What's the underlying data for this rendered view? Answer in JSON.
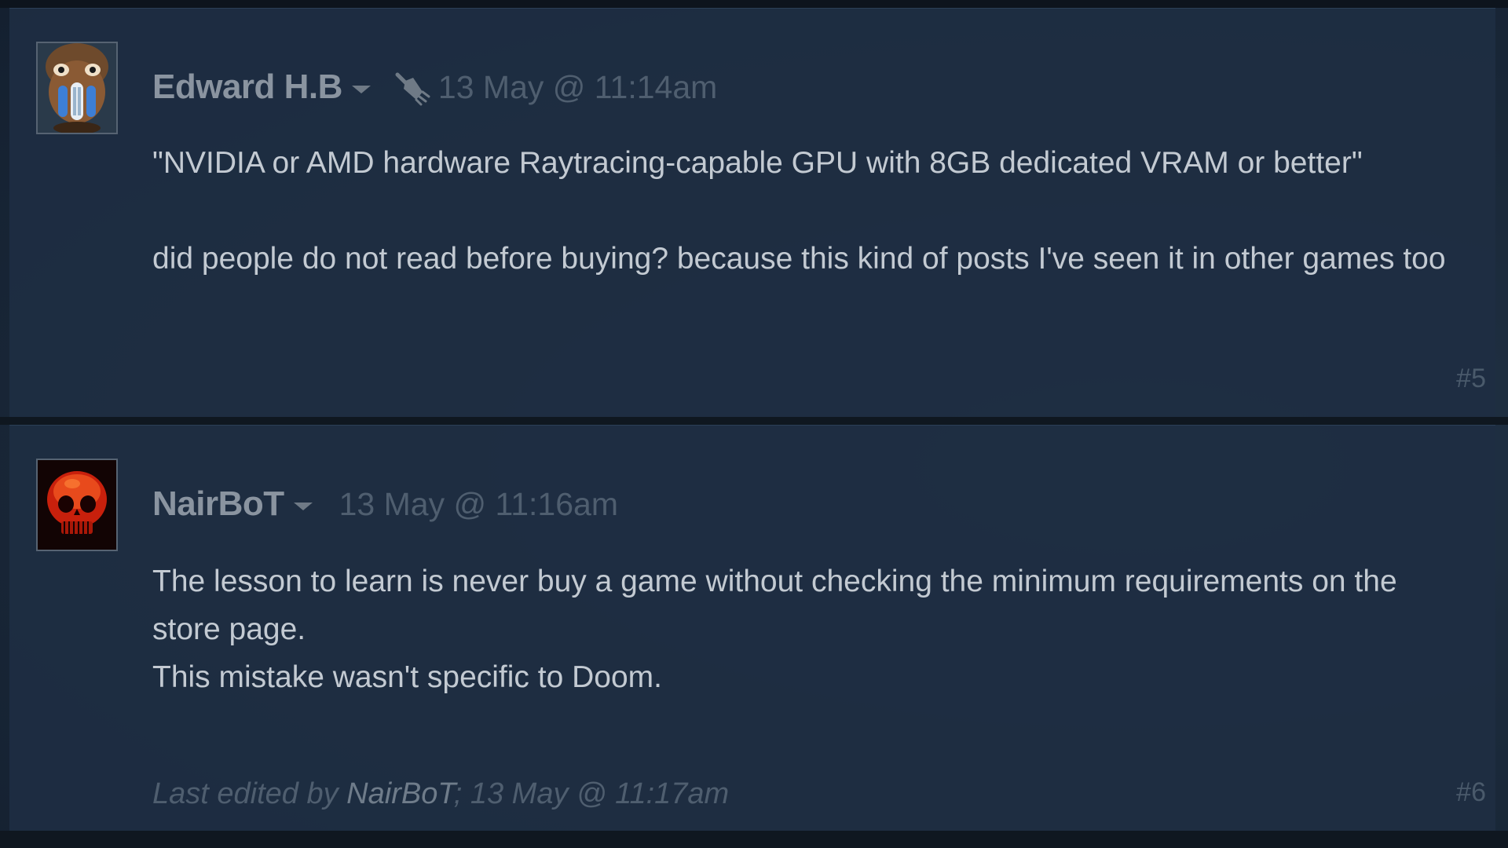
{
  "comments": [
    {
      "author": "Edward H.B",
      "timestamp": "13 May @ 11:14am",
      "badge_icon": "broom-icon",
      "paragraphs": [
        "\"NVIDIA or AMD hardware Raytracing-capable GPU with 8GB dedicated VRAM or better\"",
        "did people do not read before buying? because this kind of posts I've seen it in other games too"
      ],
      "post_number": "#5"
    },
    {
      "author": "NairBoT",
      "timestamp": "13 May @ 11:16am",
      "paragraphs": [
        "The lesson to learn is never buy a game without checking the minimum requirements on the store page.",
        "This mistake wasn't specific to Doom."
      ],
      "edited_prefix": "Last edited by ",
      "edited_by": "NairBoT",
      "edited_suffix": "; 13 May @ 11:17am",
      "post_number": "#6"
    }
  ],
  "colors": {
    "background": "#1b2a3b",
    "author": "#8a94a0",
    "timestamp": "#4f5e6f",
    "text": "#c3cad2"
  }
}
